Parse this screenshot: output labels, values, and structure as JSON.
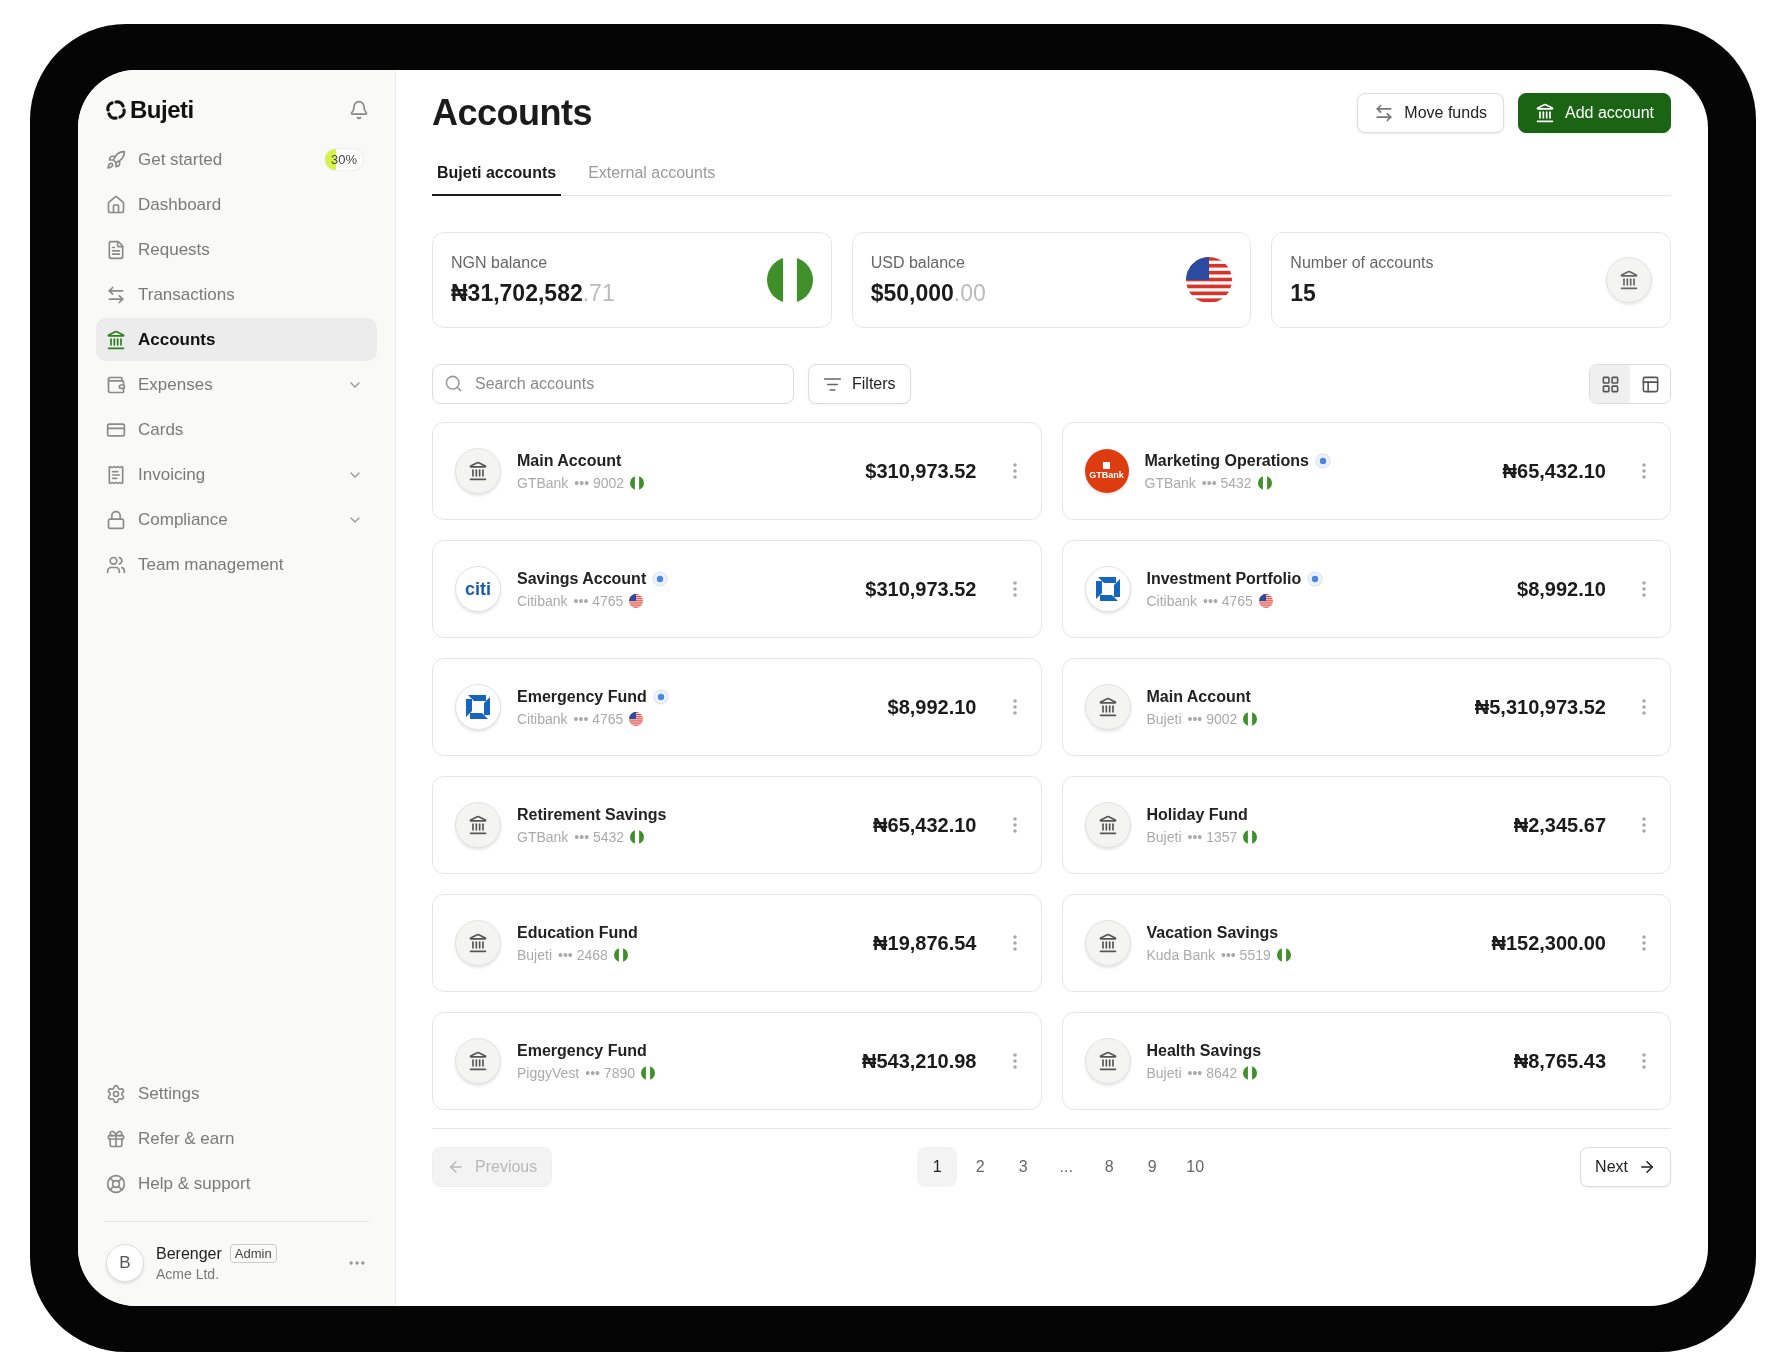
{
  "sidebar": {
    "brand": "Bujeti",
    "items": [
      {
        "label": "Get started",
        "selected": false,
        "kind": "progress",
        "badge": "30%",
        "level": 0.3
      },
      {
        "label": "Dashboard",
        "selected": false,
        "kind": "link"
      },
      {
        "label": "Requests",
        "selected": false,
        "kind": "link"
      },
      {
        "label": "Transactions",
        "selected": false,
        "kind": "link"
      },
      {
        "label": "Accounts",
        "selected": true,
        "kind": "link"
      },
      {
        "label": "Expenses",
        "selected": false,
        "kind": "group"
      },
      {
        "label": "Cards",
        "selected": false,
        "kind": "link"
      },
      {
        "label": "Invoicing",
        "selected": false,
        "kind": "group"
      },
      {
        "label": "Compliance",
        "selected": false,
        "kind": "group"
      },
      {
        "label": "Team management",
        "selected": false,
        "kind": "link"
      }
    ],
    "footer_items": [
      {
        "label": "Settings"
      },
      {
        "label": "Refer & earn"
      },
      {
        "label": "Help & support"
      }
    ],
    "user": {
      "initial": "B",
      "name": "Berenger",
      "role": "Admin",
      "company": "Acme Ltd."
    }
  },
  "header": {
    "title": "Accounts",
    "buttons": [
      {
        "label": "Move funds",
        "kind": "secondary"
      },
      {
        "label": "Add account",
        "kind": "primary"
      }
    ]
  },
  "tabs": [
    {
      "label": "Bujeti accounts",
      "selected": true
    },
    {
      "label": "External accounts",
      "selected": false
    }
  ],
  "summary": [
    {
      "label": "NGN balance",
      "value": "₦31,702,582",
      "decimals": ".71",
      "kind": "ng"
    },
    {
      "label": "USD balance",
      "value": "$50,000",
      "decimals": ".00",
      "kind": "us"
    },
    {
      "label": "Number of accounts",
      "value": "15",
      "kind": "bank"
    }
  ],
  "search": {
    "placeholder": "Search accounts"
  },
  "filters": {
    "label": "Filters"
  },
  "views": [
    {
      "kind": "grid",
      "selected": true
    },
    {
      "kind": "table",
      "selected": false
    }
  ],
  "accounts": [
    {
      "name": "Main Account",
      "bank": "GTBank",
      "number": "••• 9002",
      "flag": {
        "kind": "ng"
      },
      "verified": false,
      "logo": {
        "kind": "bank"
      },
      "amount": "$310,973.52"
    },
    {
      "name": "Marketing Operations",
      "bank": "GTBank",
      "number": "••• 5432",
      "flag": {
        "kind": "ng"
      },
      "verified": true,
      "logo": {
        "kind": "gtbank",
        "text": "GTBank"
      },
      "amount": "₦65,432.10"
    },
    {
      "name": "Savings Account",
      "bank": "Citibank",
      "number": "••• 4765",
      "flag": {
        "kind": "us"
      },
      "verified": true,
      "logo": {
        "kind": "citi",
        "text": "citi"
      },
      "amount": "$310,973.52"
    },
    {
      "name": "Investment Portfolio",
      "bank": "Citibank",
      "number": "••• 4765",
      "flag": {
        "kind": "us"
      },
      "verified": true,
      "logo": {
        "kind": "chase"
      },
      "amount": "$8,992.10"
    },
    {
      "name": "Emergency Fund",
      "bank": "Citibank",
      "number": "••• 4765",
      "flag": {
        "kind": "us"
      },
      "verified": true,
      "logo": {
        "kind": "chase"
      },
      "amount": "$8,992.10"
    },
    {
      "name": "Main Account",
      "bank": "Bujeti",
      "number": "••• 9002",
      "flag": {
        "kind": "ng"
      },
      "verified": false,
      "logo": {
        "kind": "bank"
      },
      "amount": "₦5,310,973.52"
    },
    {
      "name": "Retirement Savings",
      "bank": "GTBank",
      "number": "••• 5432",
      "flag": {
        "kind": "ng"
      },
      "verified": false,
      "logo": {
        "kind": "bank"
      },
      "amount": "₦65,432.10"
    },
    {
      "name": "Holiday Fund",
      "bank": "Bujeti",
      "number": "••• 1357",
      "flag": {
        "kind": "ng"
      },
      "verified": false,
      "logo": {
        "kind": "bank"
      },
      "amount": "₦2,345.67"
    },
    {
      "name": "Education Fund",
      "bank": "Bujeti",
      "number": "••• 2468",
      "flag": {
        "kind": "ng"
      },
      "verified": false,
      "logo": {
        "kind": "bank"
      },
      "amount": "₦19,876.54"
    },
    {
      "name": "Vacation Savings",
      "bank": "Kuda Bank",
      "number": "••• 5519",
      "flag": {
        "kind": "ng"
      },
      "verified": false,
      "logo": {
        "kind": "bank"
      },
      "amount": "₦152,300.00"
    },
    {
      "name": "Emergency Fund",
      "bank": "PiggyVest",
      "number": "••• 7890",
      "flag": {
        "kind": "ng"
      },
      "verified": false,
      "logo": {
        "kind": "bank"
      },
      "amount": "₦543,210.98"
    },
    {
      "name": "Health Savings",
      "bank": "Bujeti",
      "number": "••• 8642",
      "flag": {
        "kind": "ng"
      },
      "verified": false,
      "logo": {
        "kind": "bank"
      },
      "amount": "₦8,765.43"
    }
  ],
  "pagination": {
    "previous": {
      "label": "Previous",
      "disabled": true
    },
    "next": {
      "label": "Next",
      "disabled": false
    },
    "pages": [
      {
        "label": "1",
        "selected": true
      },
      {
        "label": "2",
        "selected": false
      },
      {
        "label": "3",
        "selected": false
      },
      {
        "label": "...",
        "selected": false
      },
      {
        "label": "8",
        "selected": false
      },
      {
        "label": "9",
        "selected": false
      },
      {
        "label": "10",
        "selected": false
      }
    ]
  }
}
